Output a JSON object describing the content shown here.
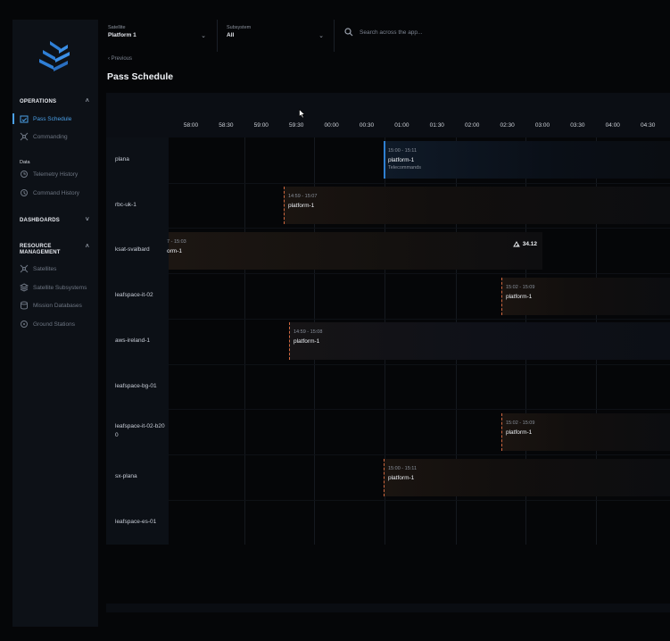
{
  "sidebar": {
    "sections": {
      "operations": "OPERATIONS",
      "data": "Data",
      "dashboards": "DASHBOARDS",
      "resource": "RESOURCE MANAGEMENT"
    },
    "items": {
      "pass_schedule": "Pass Schedule",
      "commanding": "Commanding",
      "telemetry_history": "Telemetry History",
      "command_history": "Command History",
      "satellites": "Satellites",
      "satellite_subsystems": "Satellite Subsystems",
      "mission_databases": "Mission Databases",
      "ground_stations": "Ground Stations"
    }
  },
  "header": {
    "satellite_label": "Satellite",
    "satellite_value": "Platform 1",
    "subsystem_label": "Subsystem",
    "subsystem_value": "All",
    "search_placeholder": "Search across the app..."
  },
  "page": {
    "previous": "‹ Previous",
    "title": "Pass Schedule"
  },
  "timeline": {
    "ticks": [
      "58:00",
      "58:30",
      "59:00",
      "59:30",
      "00:00",
      "00:30",
      "01:00",
      "01:30",
      "02:00",
      "02:30",
      "03:00",
      "03:30",
      "04:00",
      "04:30"
    ]
  },
  "stations": [
    "plana",
    "rbc-uk-1",
    "ksat-svalbard",
    "leafspace-it-02",
    "aws-ireland-1",
    "leafspace-bg-01",
    "leafspace-it-02-b200",
    "sx-plana",
    "leafspace-es-01"
  ],
  "passes": {
    "plana": {
      "time": "15:00 - 15:11",
      "sat": "platform-1",
      "sub": "Telecommands"
    },
    "rbc": {
      "time": "14:59 - 15:07",
      "sat": "platform-1"
    },
    "svalbard": {
      "time": "7 - 15:03",
      "sat": "orm-1",
      "elevation": "34.12"
    },
    "it02": {
      "time": "15:02 - 15:09",
      "sat": "platform-1"
    },
    "aws": {
      "time": "14:59 - 15:08",
      "sat": "platform-1"
    },
    "it02b200": {
      "time": "15:02 - 15:09",
      "sat": "platform-1"
    },
    "sxplana": {
      "time": "15:00 - 15:11",
      "sat": "platform-1"
    }
  },
  "colors": {
    "accent": "#4a9fe6",
    "pass_blue": "#2e7fd1",
    "pass_orange": "#d0683f",
    "sidebar_bg": "#0d1117",
    "page_bg": "#050608"
  }
}
